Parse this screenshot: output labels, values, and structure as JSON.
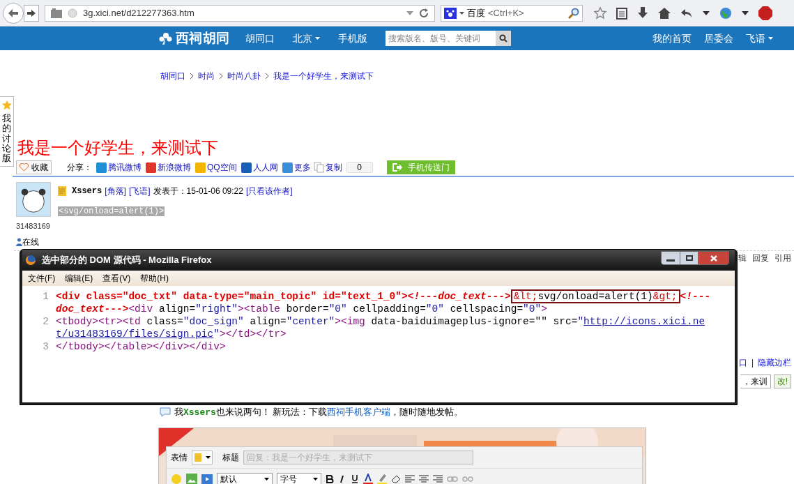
{
  "browser": {
    "url": "3g.xici.net/d212277363.htm",
    "search_engine": "百度",
    "search_placeholder": "<Ctrl+K>"
  },
  "nav": {
    "logo": "西祠胡同",
    "items": [
      {
        "label": "胡同口",
        "dropdown": false
      },
      {
        "label": "北京",
        "dropdown": true
      },
      {
        "label": "手机版",
        "dropdown": false
      }
    ],
    "search_placeholder": "搜索版名、版号、关键词",
    "right_items": [
      {
        "label": "我的首页",
        "dropdown": false
      },
      {
        "label": "居委会",
        "dropdown": false
      },
      {
        "label": "飞语",
        "dropdown": true
      }
    ]
  },
  "breadcrumb": [
    "胡同口",
    "时尚",
    "时尚八卦",
    "我是一个好学生，来测试下"
  ],
  "side_tab": "我的讨论版",
  "title": "我是一个好学生，来测试下",
  "actions": {
    "favorite": "收藏",
    "share_label": "分享：",
    "share": [
      {
        "label": "腾讯微博",
        "color": "#1e8fd6"
      },
      {
        "label": "新浪微博",
        "color": "#e0352b"
      },
      {
        "label": "QQ空间",
        "color": "#f5b400"
      },
      {
        "label": "人人网",
        "color": "#1a5fb4"
      },
      {
        "label": "更多",
        "color": "#3b8fd8"
      }
    ],
    "copy": "复制",
    "count": "0",
    "mobile": "手机传送门"
  },
  "post": {
    "user_id": "31483169",
    "online": "在线",
    "author": "Xssers",
    "links": [
      "[角落]",
      "[飞语]"
    ],
    "posted": "发表于：15-01-06 09:22",
    "only_author": "[只看该作者]",
    "content": "<svg/onload=alert(1)>",
    "content_selected": true,
    "tools": [
      "辑",
      "回复",
      "引用"
    ]
  },
  "sidebar_links": [
    "口",
    "|",
    "隐藏边栏"
  ],
  "quick_reply": {
    "value": "，来训",
    "button": "改!"
  },
  "comment": {
    "prefix": "我",
    "user": "Xssers",
    "suffix": "也来说两句！ 新玩法：下载",
    "link": "西祠手机客户端",
    "end": "，随时随地发帖。"
  },
  "editor": {
    "emotion": "表情",
    "title_label": "标题",
    "title_placeholder": "回复：我是一个好学生，来测试下",
    "font": "默认",
    "size": "字号"
  },
  "dialog": {
    "title": "选中部分的 DOM 源代码 - Mozilla Firefox",
    "menu": [
      "文件(F)",
      "编辑(E)",
      "查看(V)",
      "帮助(H)"
    ],
    "lines": [
      {
        "number": "1",
        "tokens": [
          {
            "kind": "selected",
            "text": "<div class=\"doc_txt\" data-type=\"main_topic\" id=\"text_1_0\">"
          },
          {
            "kind": "comment",
            "text": "<!---doc_text--->"
          },
          {
            "kind": "boxed",
            "tokens": [
              {
                "kind": "entity",
                "text": "&lt;"
              },
              {
                "kind": "text",
                "text": "svg/onload=alert(1)"
              },
              {
                "kind": "entity",
                "text": "&gt;"
              }
            ]
          },
          {
            "kind": "comment",
            "text": "<!---doc_text--->"
          },
          {
            "kind": "tag",
            "text": "<div "
          },
          {
            "kind": "attr",
            "text": "align="
          },
          {
            "kind": "value",
            "text": "\"right\""
          },
          {
            "kind": "tag",
            "text": ">"
          },
          {
            "kind": "tag",
            "text": "<table "
          },
          {
            "kind": "attr",
            "text": "border="
          },
          {
            "kind": "value",
            "text": "\"0\""
          },
          {
            "kind": "attr",
            "text": " cellpadding="
          },
          {
            "kind": "value",
            "text": "\"0\""
          },
          {
            "kind": "attr",
            "text": " cellspacing="
          },
          {
            "kind": "value",
            "text": "\"0\""
          },
          {
            "kind": "tag",
            "text": ">"
          }
        ]
      },
      {
        "number": "2",
        "tokens": [
          {
            "kind": "tag",
            "text": "<tbody><tr><td "
          },
          {
            "kind": "attr",
            "text": "class="
          },
          {
            "kind": "value",
            "text": "\"doc_sign\""
          },
          {
            "kind": "attr",
            "text": " align="
          },
          {
            "kind": "value",
            "text": "\"center\""
          },
          {
            "kind": "tag",
            "text": "><img "
          },
          {
            "kind": "attr",
            "text": "data-baiduimageplus-ignore=\"\" src="
          },
          {
            "kind": "value",
            "text": "\""
          },
          {
            "kind": "link",
            "text": "http://icons.xici.net/u31483169/files/sign.pic"
          },
          {
            "kind": "value",
            "text": "\""
          },
          {
            "kind": "tag",
            "text": "></td></tr>"
          }
        ]
      },
      {
        "number": "3",
        "tokens": [
          {
            "kind": "tag",
            "text": "</tbody></table></div></div>"
          }
        ]
      }
    ]
  }
}
